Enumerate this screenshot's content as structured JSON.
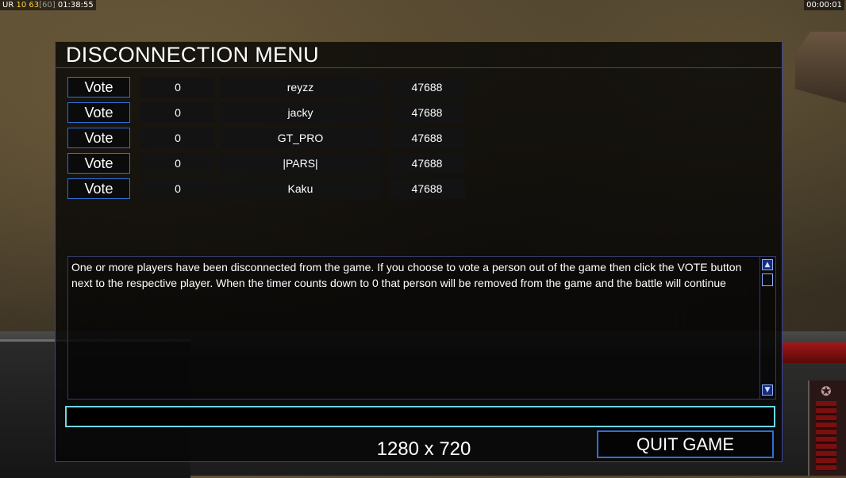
{
  "overlay": {
    "status_prefix": "UR ",
    "status_a": "10",
    "status_b": "63",
    "status_c": "[60]",
    "clock": "01:38:55",
    "timer": "00:00:01"
  },
  "dialog": {
    "title": "DISCONNECTION MENU",
    "vote_label": "Vote",
    "players": [
      {
        "count": "0",
        "name": "reyzz",
        "ping": "47688"
      },
      {
        "count": "0",
        "name": "jacky",
        "ping": "47688"
      },
      {
        "count": "0",
        "name": "GT_PRO",
        "ping": "47688"
      },
      {
        "count": "0",
        "name": "|PARS|",
        "ping": "47688"
      },
      {
        "count": "0",
        "name": "Kaku",
        "ping": "47688"
      }
    ],
    "message": "One or more players have been disconnected from the game. If you choose to vote a person out of the game then click the VOTE button next to the respective player. When the timer counts down to 0 that person will be removed from the game and the battle will continue",
    "chat_value": "",
    "resolution": "1280 x 720",
    "quit_label": "QUIT GAME"
  },
  "colors": {
    "panel_border": "#3a43a8",
    "button_border": "#2f6fd8",
    "input_border": "#6fd6e6"
  }
}
